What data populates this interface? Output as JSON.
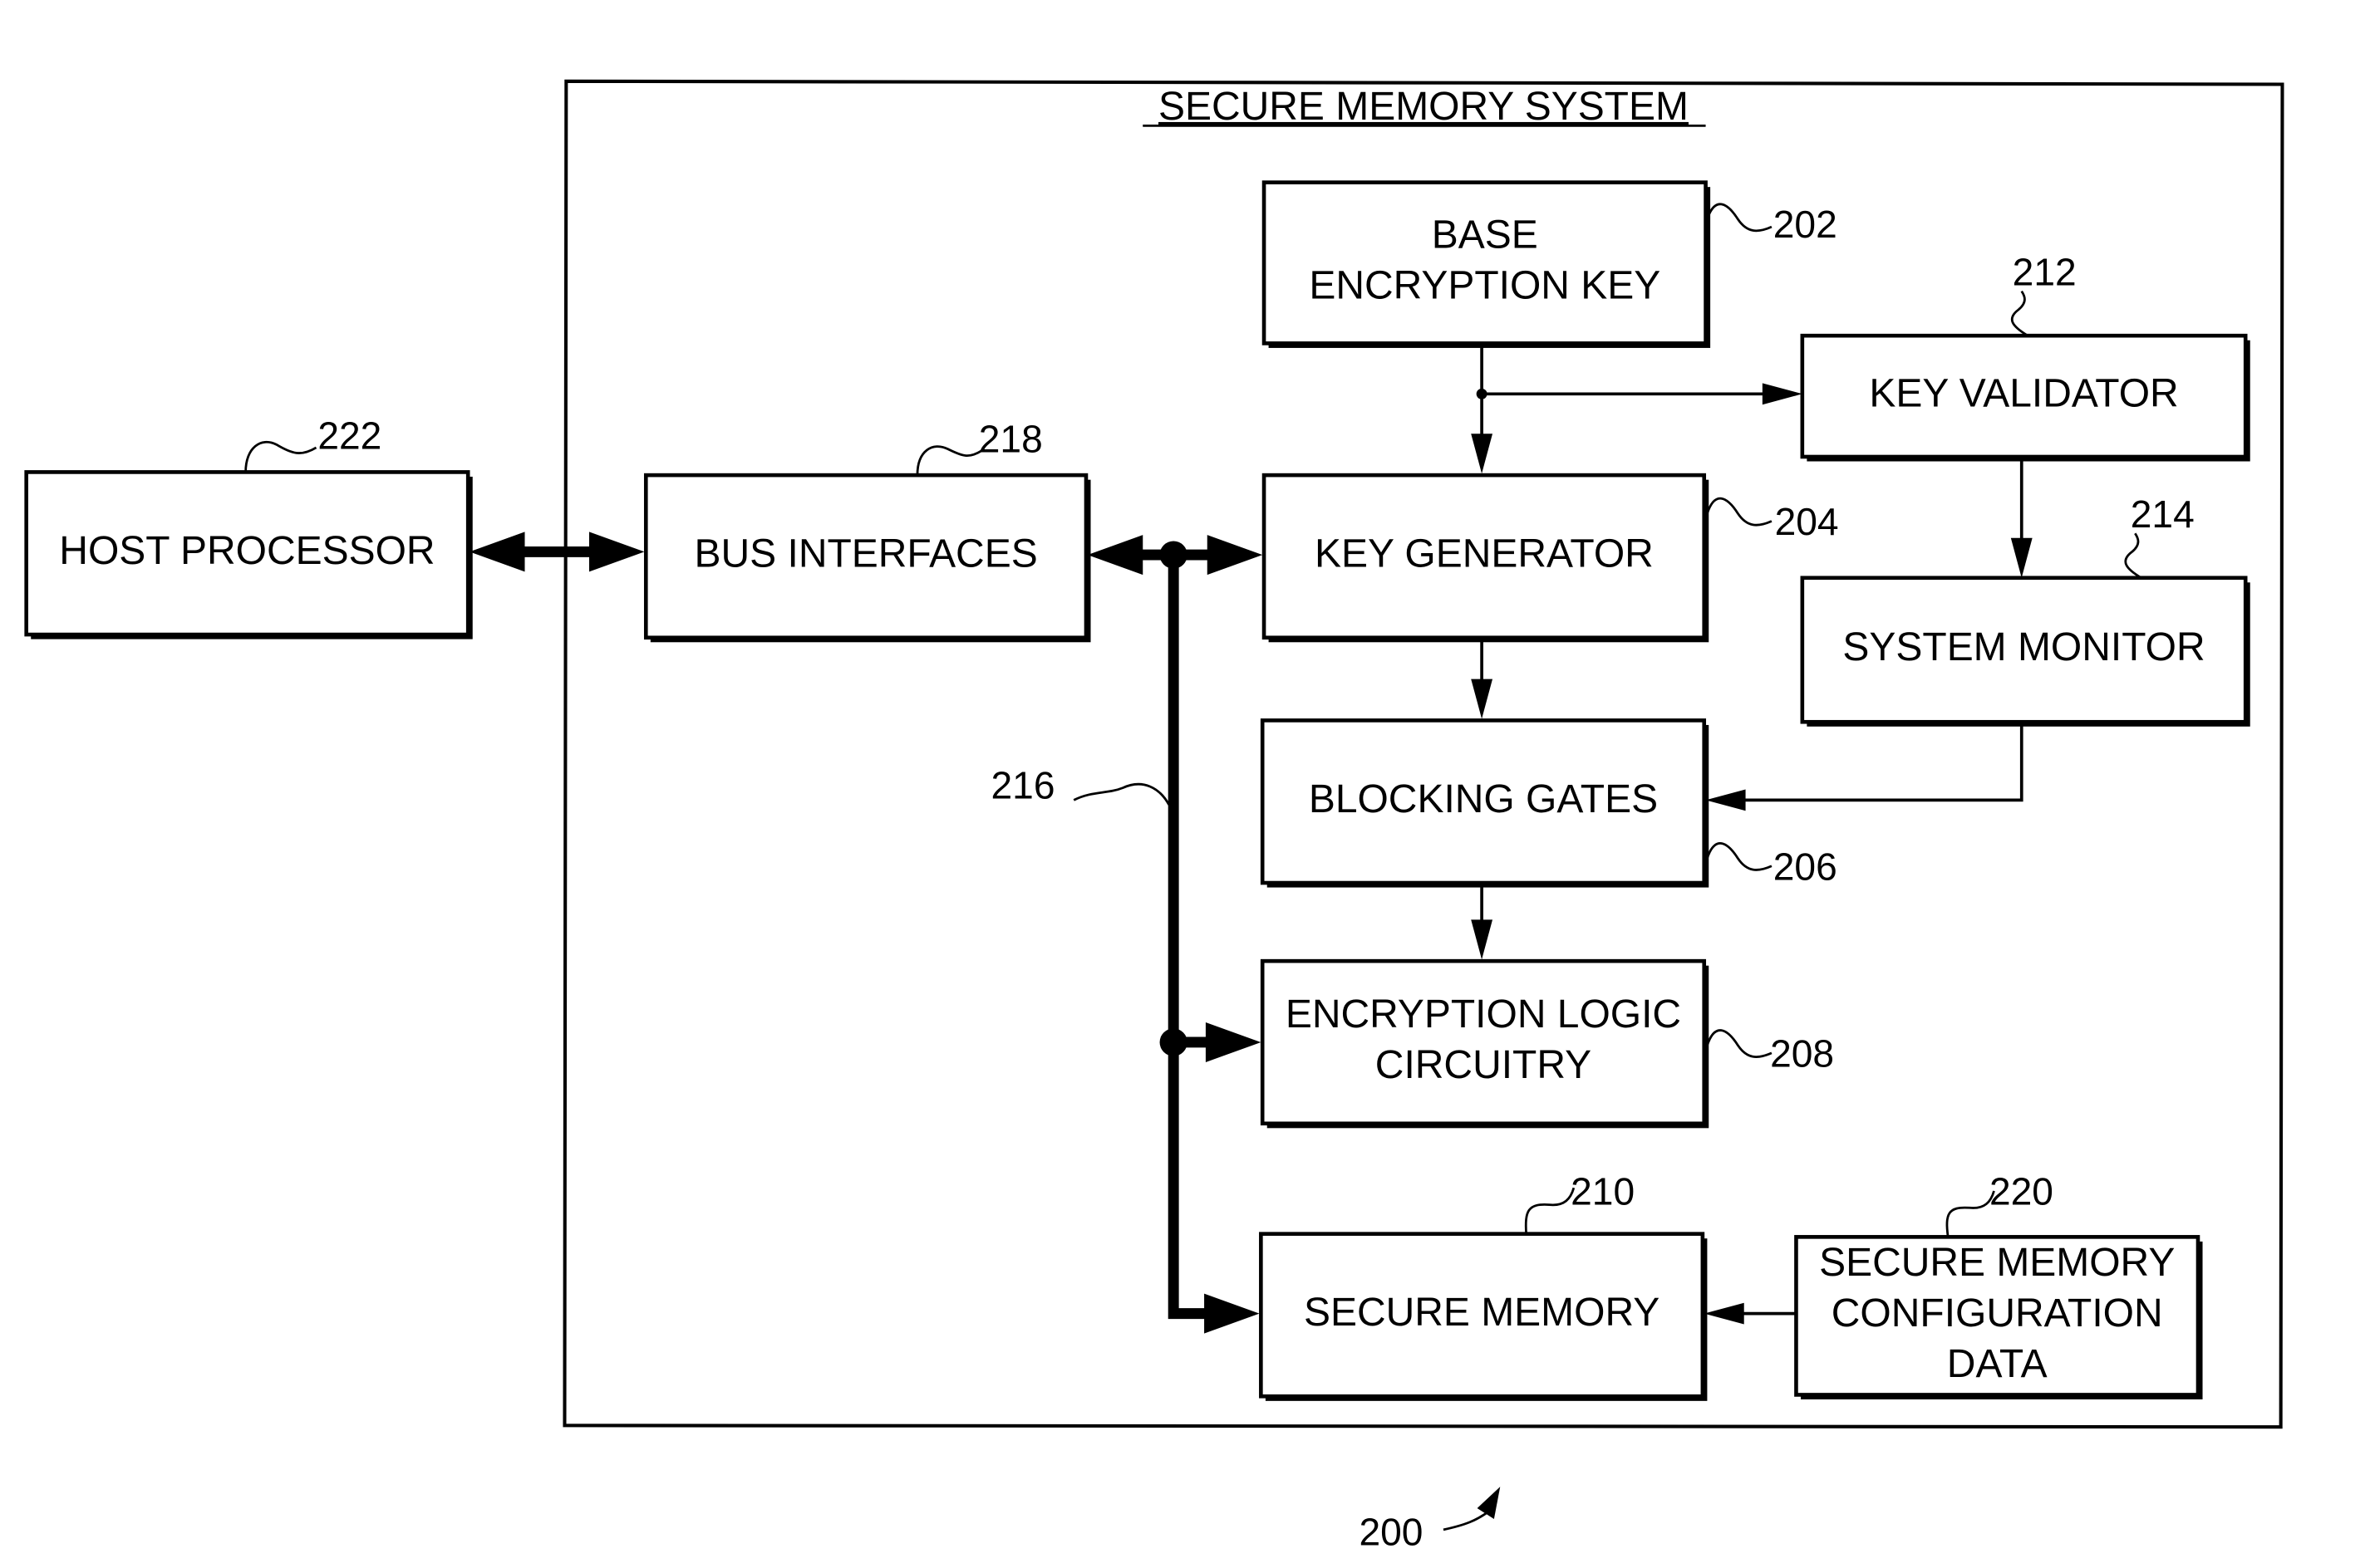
{
  "figure": {
    "title": "SECURE MEMORY SYSTEM",
    "figure_ref": "200",
    "bus_ref": "216"
  },
  "blocks": {
    "host_processor": {
      "lines": [
        "HOST PROCESSOR"
      ],
      "ref": "222"
    },
    "bus_interfaces": {
      "lines": [
        "BUS INTERFACES"
      ],
      "ref": "218"
    },
    "base_encryption_key": {
      "lines": [
        "BASE",
        "ENCRYPTION KEY"
      ],
      "ref": "202"
    },
    "key_validator": {
      "lines": [
        "KEY VALIDATOR"
      ],
      "ref": "212"
    },
    "key_generator": {
      "lines": [
        "KEY GENERATOR"
      ],
      "ref": "204"
    },
    "system_monitor": {
      "lines": [
        "SYSTEM MONITOR"
      ],
      "ref": "214"
    },
    "blocking_gates": {
      "lines": [
        "BLOCKING GATES"
      ],
      "ref": "206"
    },
    "encryption_logic": {
      "lines": [
        "ENCRYPTION LOGIC",
        "CIRCUITRY"
      ],
      "ref": "208"
    },
    "secure_memory": {
      "lines": [
        "SECURE MEMORY"
      ],
      "ref": "210"
    },
    "config_data": {
      "lines": [
        "SECURE MEMORY",
        "CONFIGURATION",
        "DATA"
      ],
      "ref": "220"
    }
  },
  "connections": [
    {
      "from": "host_processor",
      "to": "bus_interfaces",
      "type": "bidirectional-bus"
    },
    {
      "from": "bus_interfaces",
      "to": "key_generator",
      "type": "bidirectional-bus"
    },
    {
      "from": "bus",
      "to": "encryption_logic",
      "type": "bus"
    },
    {
      "from": "bus",
      "to": "secure_memory",
      "type": "bus"
    },
    {
      "from": "base_encryption_key",
      "to": "key_generator",
      "type": "signal"
    },
    {
      "from": "base_encryption_key",
      "to": "key_validator",
      "type": "signal"
    },
    {
      "from": "key_validator",
      "to": "system_monitor",
      "type": "signal"
    },
    {
      "from": "system_monitor",
      "to": "blocking_gates",
      "type": "signal"
    },
    {
      "from": "key_generator",
      "to": "blocking_gates",
      "type": "signal"
    },
    {
      "from": "blocking_gates",
      "to": "encryption_logic",
      "type": "signal"
    },
    {
      "from": "config_data",
      "to": "secure_memory",
      "type": "signal"
    }
  ]
}
